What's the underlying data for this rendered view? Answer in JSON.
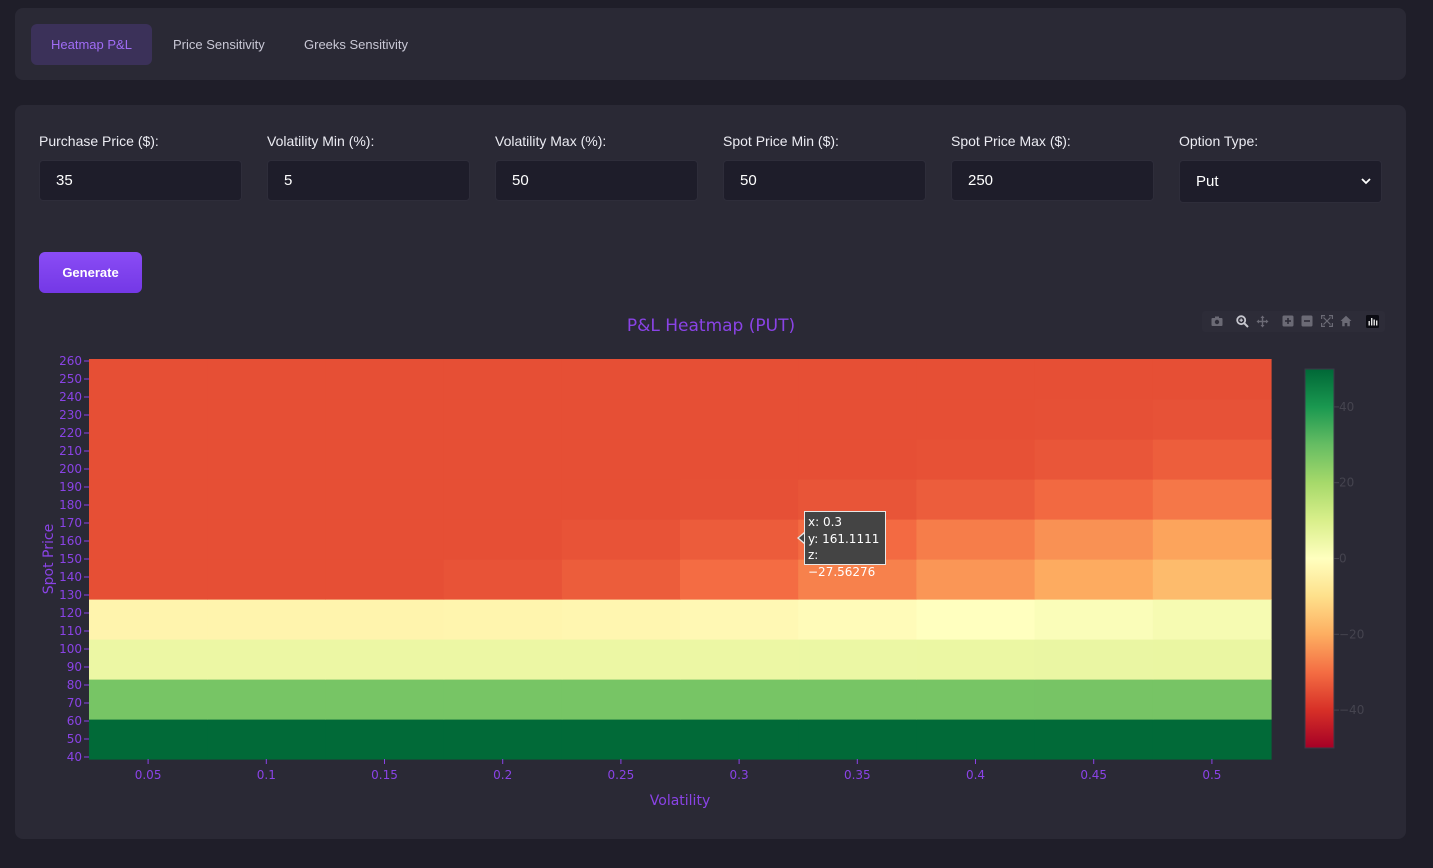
{
  "tabs": [
    {
      "label": "Heatmap P&L",
      "active": true
    },
    {
      "label": "Price Sensitivity",
      "active": false
    },
    {
      "label": "Greeks Sensitivity",
      "active": false
    }
  ],
  "form": {
    "purchase_price": {
      "label": "Purchase Price ($):",
      "value": "35"
    },
    "vol_min": {
      "label": "Volatility Min (%):",
      "value": "5"
    },
    "vol_max": {
      "label": "Volatility Max (%):",
      "value": "50"
    },
    "spot_min": {
      "label": "Spot Price Min ($):",
      "value": "50"
    },
    "spot_max": {
      "label": "Spot Price Max ($):",
      "value": "250"
    },
    "option_type": {
      "label": "Option Type:",
      "value": "Put"
    }
  },
  "generate_label": "Generate",
  "toolbar_icons": [
    "camera-icon",
    "zoom-icon",
    "pan-icon",
    "zoom-in-icon",
    "zoom-out-icon",
    "autoscale-icon",
    "home-icon",
    "plotly-logo-icon"
  ],
  "colors": {
    "accent": "#8a43e6",
    "button": "#7c3aed",
    "panel": "#2a2935",
    "background": "#1f1e29"
  },
  "chart_data": {
    "type": "heatmap",
    "title": "P&L Heatmap (PUT)",
    "xlabel": "Volatility",
    "ylabel": "Spot Price",
    "x": [
      0.05,
      0.1,
      0.15,
      0.2,
      0.25,
      0.3,
      0.35,
      0.4,
      0.45,
      0.5
    ],
    "y": [
      50,
      72.2222,
      94.4444,
      116.6667,
      138.8889,
      161.1111,
      183.3333,
      205.5556,
      227.7778,
      250
    ],
    "z": [
      [
        49.5,
        49.5,
        49.5,
        49.5,
        49.5,
        49.5,
        49.5,
        49.5,
        49.5,
        49.5
      ],
      [
        27.3,
        27.3,
        27.3,
        27.3,
        27.3,
        27.3,
        27.3,
        27.3,
        27.4,
        27.4
      ],
      [
        5.1,
        5.1,
        5.1,
        5.1,
        5.1,
        5.1,
        5.2,
        5.3,
        5.4,
        5.5
      ],
      [
        -3.5,
        -3.5,
        -3.4,
        -3.3,
        -2.9,
        -2.2,
        -1.2,
        0,
        1.2,
        2.5
      ],
      [
        -35,
        -35,
        -34.9,
        -34.3,
        -32.7,
        -30.1,
        -27.0,
        -23.7,
        -20.5,
        -17.5
      ],
      [
        -35,
        -35,
        -35,
        -34.9,
        -34.3,
        -32.8,
        -30.5,
        -27.56276,
        -24.5,
        -21.6
      ],
      [
        -35,
        -35,
        -35,
        -35,
        -35,
        -34.7,
        -34.0,
        -32.6,
        -30.7,
        -28.5
      ],
      [
        -35,
        -35,
        -35,
        -35,
        -35,
        -35,
        -34.9,
        -34.6,
        -33.7,
        -32.4
      ],
      [
        -35,
        -35,
        -35,
        -35,
        -35,
        -35,
        -35,
        -35,
        -34.7,
        -34.4
      ],
      [
        -35,
        -35,
        -35,
        -35,
        -35,
        -35,
        -35,
        -35,
        -35,
        -34.9
      ]
    ],
    "x_ticks": [
      "0.05",
      "0.1",
      "0.15",
      "0.2",
      "0.25",
      "0.3",
      "0.35",
      "0.4",
      "0.45",
      "0.5"
    ],
    "y_ticks": [
      "40",
      "50",
      "60",
      "70",
      "80",
      "90",
      "100",
      "110",
      "120",
      "130",
      "140",
      "150",
      "160",
      "170",
      "180",
      "190",
      "200",
      "210",
      "220",
      "230",
      "240",
      "250",
      "260"
    ],
    "y_range": [
      38.8889,
      261.1111
    ],
    "colorscale": "RdYlGn",
    "zmin": -50,
    "zmax": 50,
    "colorbar_ticks": [
      "40",
      "20",
      "0",
      "−20",
      "−40"
    ],
    "colorbar_tick_values": [
      40,
      20,
      0,
      -20,
      -40
    ]
  },
  "tooltip": {
    "x": "x: 0.3",
    "y": "y: 161.1111",
    "z": "z: −27.56276"
  }
}
